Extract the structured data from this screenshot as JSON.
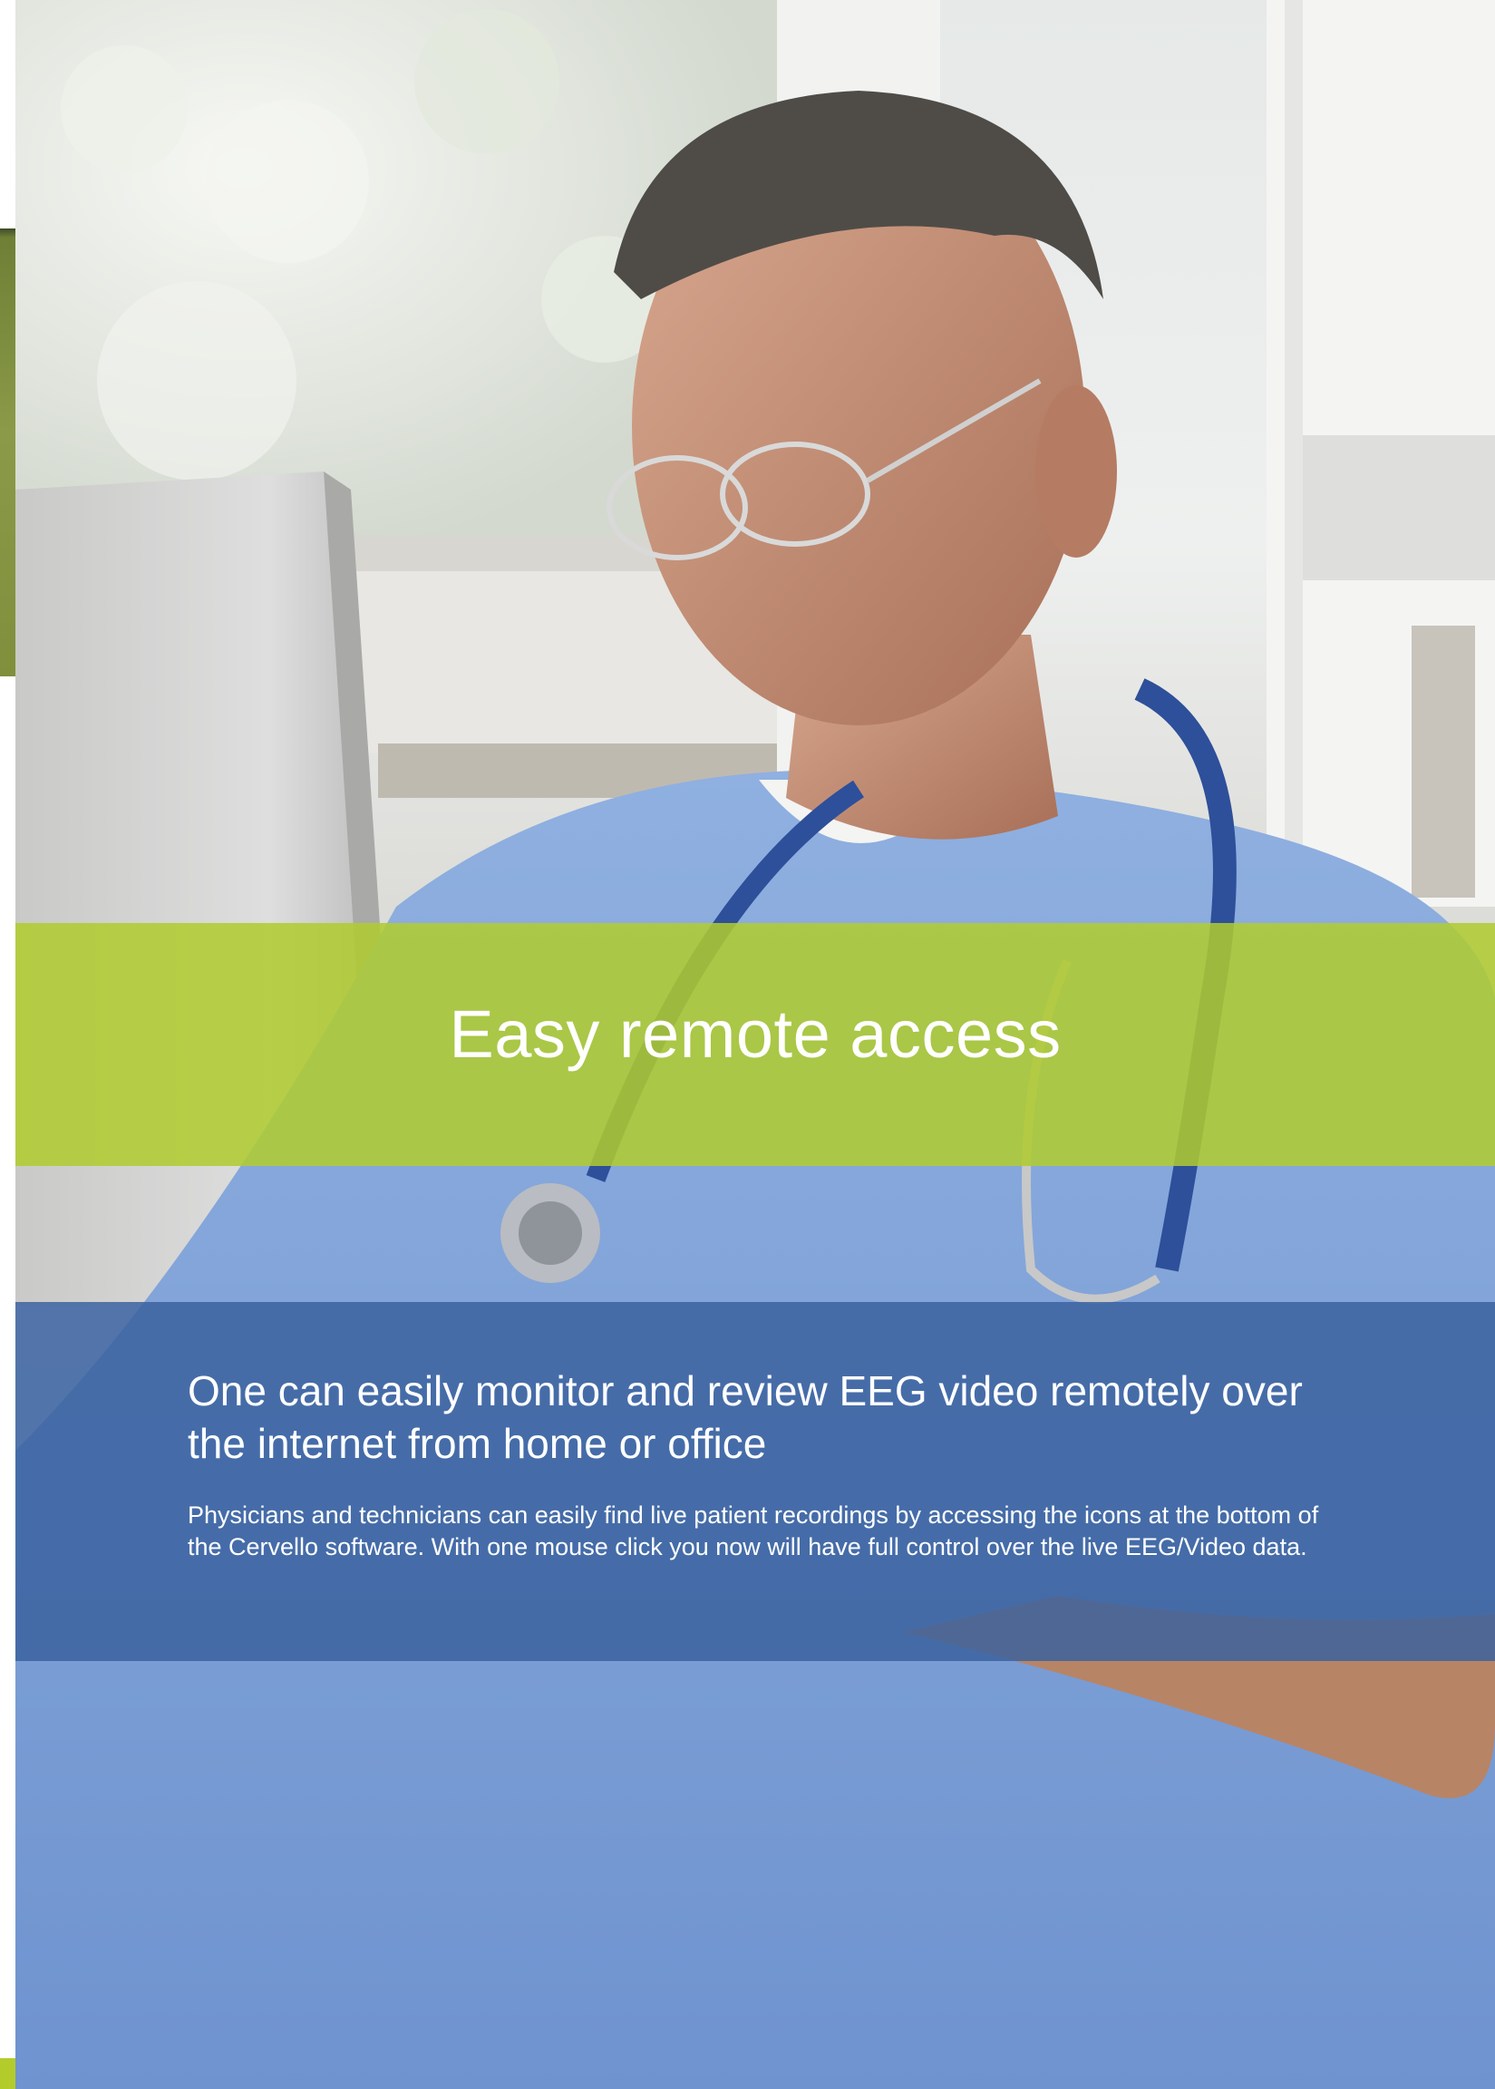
{
  "page": {
    "headline": "Easy remote access",
    "subheading": "One can easily monitor and review EEG video remotely over the internet from home or office",
    "body": "Physicians and technicians can easily find live patient recordings by accessing the icons at the bottom of the Cervello software. With one mouse click you now will have full control over the live EEG/Video data."
  },
  "colors": {
    "green_band": "#b0cc2e",
    "blue_band": "#3a629e",
    "text": "#ffffff"
  }
}
